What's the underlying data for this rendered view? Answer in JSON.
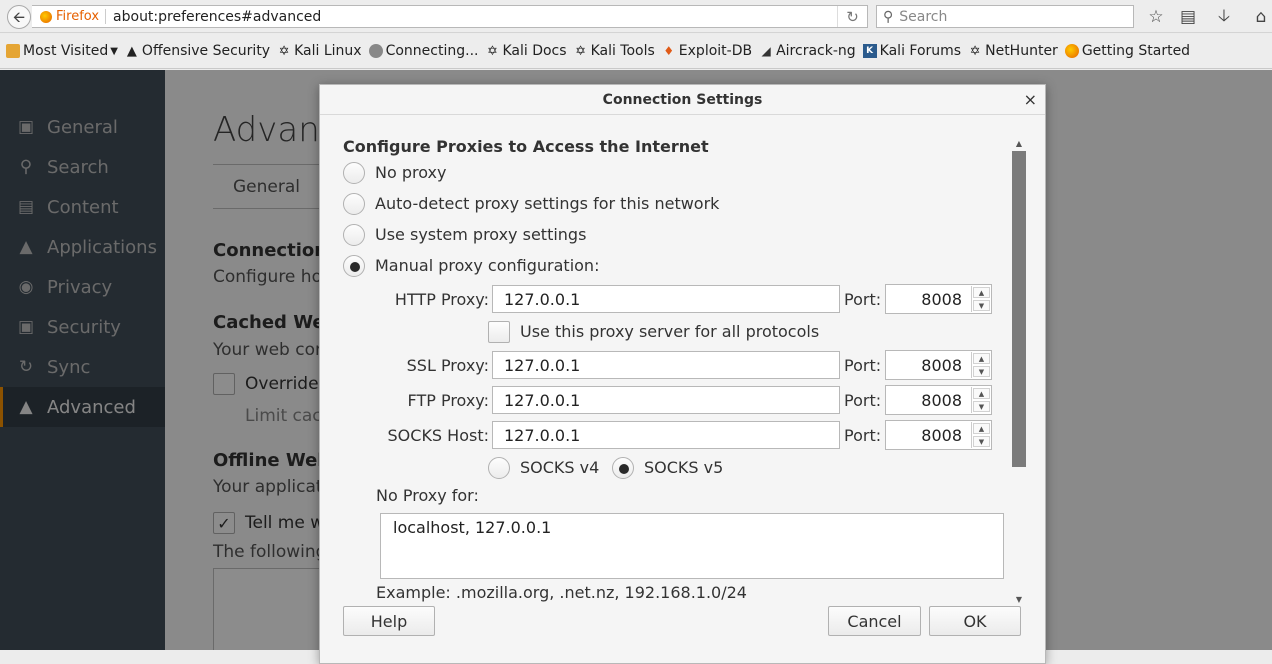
{
  "toolbar": {
    "browser_label": "Firefox",
    "url": "about:preferences#advanced",
    "search_placeholder": "Search"
  },
  "bookmarks": [
    {
      "label": "Most Visited",
      "icon": "folder-icon"
    },
    {
      "label": "Offensive Security",
      "icon": "offsec-icon"
    },
    {
      "label": "Kali Linux",
      "icon": "kali-dragon-icon"
    },
    {
      "label": "Connecting...",
      "icon": "globe-icon"
    },
    {
      "label": "Kali Docs",
      "icon": "kali-dragon-icon"
    },
    {
      "label": "Kali Tools",
      "icon": "kali-dragon-icon"
    },
    {
      "label": "Exploit-DB",
      "icon": "exploit-db-icon"
    },
    {
      "label": "Aircrack-ng",
      "icon": "aircrack-icon"
    },
    {
      "label": "Kali Forums",
      "icon": "kali-forums-icon"
    },
    {
      "label": "NetHunter",
      "icon": "kali-dragon-icon"
    },
    {
      "label": "Getting Started",
      "icon": "firefox-icon"
    }
  ],
  "sidebar": {
    "items": [
      {
        "label": "General",
        "icon": "general-icon"
      },
      {
        "label": "Search",
        "icon": "search-icon"
      },
      {
        "label": "Content",
        "icon": "content-icon"
      },
      {
        "label": "Applications",
        "icon": "applications-icon"
      },
      {
        "label": "Privacy",
        "icon": "privacy-mask-icon"
      },
      {
        "label": "Security",
        "icon": "lock-icon"
      },
      {
        "label": "Sync",
        "icon": "sync-icon"
      },
      {
        "label": "Advanced",
        "icon": "advanced-hat-icon",
        "active": true
      }
    ]
  },
  "content": {
    "title": "Advanc",
    "tab_general": "General",
    "connection_heading": "Connection",
    "connection_desc": "Configure hov",
    "cached_heading": "Cached Web",
    "cached_desc": "Your web cor",
    "override_label": "Override",
    "limit_label": "Limit cach",
    "offline_heading": "Offline Web",
    "offline_desc": "Your applicat",
    "tell_me_label": "Tell me w",
    "following_label": "The following"
  },
  "dialog": {
    "title": "Connection Settings",
    "close_glyph": "×",
    "heading": "Configure Proxies to Access the Internet",
    "options": {
      "no_proxy": "No proxy",
      "auto_detect": "Auto-detect proxy settings for this network",
      "use_system": "Use system proxy settings",
      "manual": "Manual proxy configuration:"
    },
    "selected_option": "manual",
    "http_label": "HTTP Proxy:",
    "http_value": "127.0.0.1",
    "http_port": "8008",
    "port_label": "Port:",
    "all_protocols_label": "Use this proxy server for all protocols",
    "all_protocols_checked": false,
    "ssl_label": "SSL Proxy:",
    "ssl_value": "127.0.0.1",
    "ssl_port": "8008",
    "ftp_label": "FTP Proxy:",
    "ftp_value": "127.0.0.1",
    "ftp_port": "8008",
    "socks_label": "SOCKS Host:",
    "socks_value": "127.0.0.1",
    "socks_port": "8008",
    "socks_v4_label": "SOCKS v4",
    "socks_v5_label": "SOCKS v5",
    "socks_selected": "v5",
    "no_proxy_label": "No Proxy for:",
    "no_proxy_value": "localhost, 127.0.0.1",
    "example_text": "Example: .mozilla.org, .net.nz, 192.168.1.0/24",
    "help_label": "Help",
    "cancel_label": "Cancel",
    "ok_label": "OK"
  }
}
